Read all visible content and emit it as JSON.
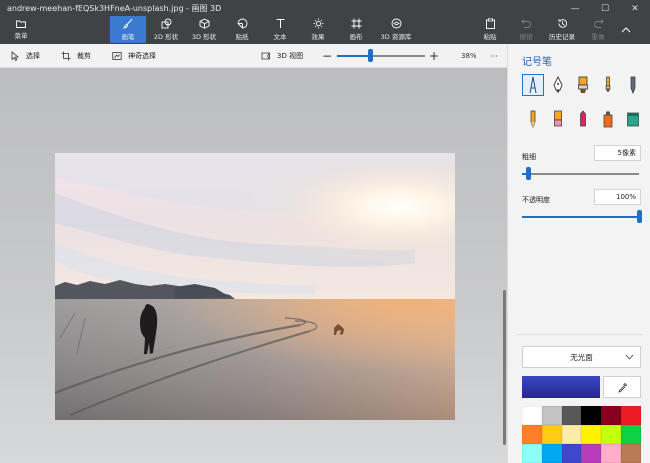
{
  "window": {
    "title": "andrew-meehan-fEQSk3HFneA-unsplash.jpg - 画图 3D",
    "minimize_glyph": "—",
    "maximize_glyph": "☐",
    "close_glyph": "✕"
  },
  "ribbon": {
    "menu_label": "菜单",
    "tools": [
      {
        "label": "画笔",
        "icon": "brush-icon",
        "active": true
      },
      {
        "label": "2D 形状",
        "icon": "2d-shapes-icon"
      },
      {
        "label": "3D 形状",
        "icon": "3d-shapes-icon"
      },
      {
        "label": "贴纸",
        "icon": "sticker-icon"
      },
      {
        "label": "文本",
        "icon": "text-icon"
      },
      {
        "label": "效果",
        "icon": "effects-icon"
      },
      {
        "label": "画布",
        "icon": "canvas-icon"
      },
      {
        "label": "3D 资源库",
        "icon": "3d-library-icon"
      }
    ],
    "right_tools": [
      {
        "label": "粘贴",
        "icon": "paste-icon"
      },
      {
        "label": "撤销",
        "icon": "undo-icon",
        "disabled": true
      },
      {
        "label": "历史记录",
        "icon": "history-icon"
      },
      {
        "label": "重做",
        "icon": "redo-icon",
        "disabled": true
      }
    ]
  },
  "toolbar": {
    "select_label": "选择",
    "crop_label": "裁剪",
    "magic_select_label": "神奇选择",
    "view3d_label": "3D 视图",
    "zoom_minus": "−",
    "zoom_plus": "+",
    "zoom_percent": "38%",
    "zoom_level": 0.38,
    "more_glyph": "···"
  },
  "panel": {
    "title": "记号笔",
    "brushes": [
      "marker-icon",
      "calligraphy-pen-icon",
      "oil-brush-icon",
      "watercolor-icon",
      "pixel-pen-icon",
      "pencil-icon",
      "eraser-icon",
      "crayon-icon",
      "spray-can-icon",
      "fill-icon"
    ],
    "thickness_label": "粗细",
    "thickness_value": "5像素",
    "thickness_level": 0.05,
    "opacity_label": "不透明度",
    "opacity_value": "100%",
    "opacity_level": 1.0,
    "finish_value": "无光面",
    "current_color": "#3b45c2",
    "swatches": [
      "#ffffff",
      "#c3c3c3",
      "#585858",
      "#000000",
      "#88001b",
      "#ec1c24",
      "#ff7f27",
      "#ffca18",
      "#fdeca6",
      "#fff200",
      "#c4ff0e",
      "#0ed145",
      "#8cfffb",
      "#00a8f3",
      "#3f48cc",
      "#b83dba",
      "#ffaec8",
      "#b97a56"
    ]
  }
}
